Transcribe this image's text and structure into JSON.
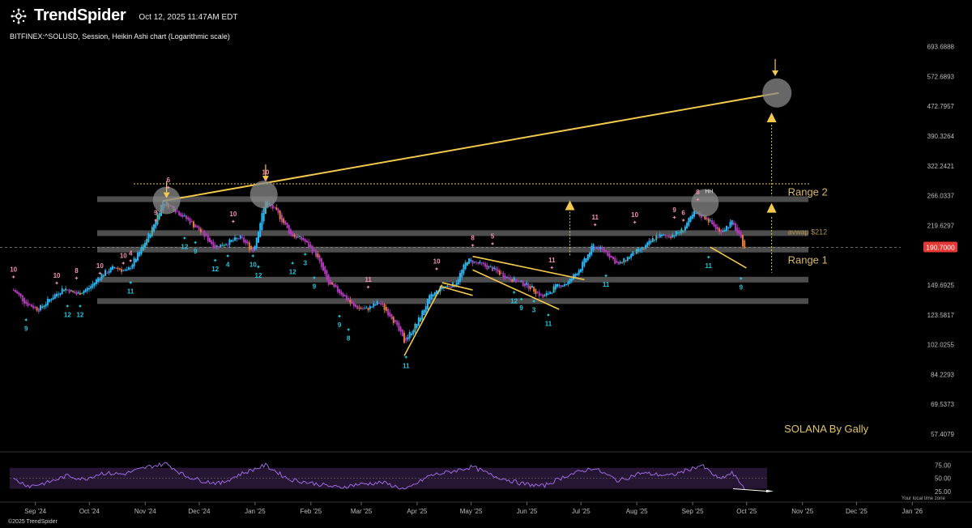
{
  "header": {
    "brand": "TrendSpider",
    "datetime": "Oct 12, 2025 11:47AM EDT",
    "symbol_line": "BITFINEX:^SOLUSD, Session, Heikin Ashi chart (Logarithmic scale)"
  },
  "footer": {
    "copyright": "©2025 TrendSpider",
    "timezone": "Your local time zone"
  },
  "colors": {
    "background": "#000000",
    "trendline": "#f2c94c",
    "zone": "#5a5a5a",
    "bull_candle": "#29b6f6",
    "bear_candle": "#b03ab8",
    "seq_top": "#f48fb1",
    "seq_bottom": "#26c6da",
    "rsi": "#9c6ade",
    "price_tag": "#e53935"
  },
  "chart_data": [
    {
      "type": "candlestick",
      "scale": "log",
      "ylim": [
        52,
        760
      ],
      "y_ticks": [
        "693.6888",
        "572.6893",
        "472.7957",
        "390.3264",
        "322.2421",
        "266.0337",
        "219.6297",
        "190.7000",
        "149.6925",
        "123.5817",
        "102.0255",
        "84.2293",
        "69.5373",
        "57.4079"
      ],
      "x_ticks": [
        "Sep '24",
        "Oct '24",
        "Nov '24",
        "Dec '24",
        "Jan '25",
        "Feb '25",
        "Mar '25",
        "Apr '25",
        "May '25",
        "Jun '25",
        "Jul '25",
        "Aug '25",
        "Sep '25",
        "Oct '25",
        "Nov '25",
        "Dec '25",
        "Jan '26"
      ],
      "last_price": "190.7000",
      "price_path": [
        [
          "2024-09-01",
          145
        ],
        [
          "2024-09-08",
          133
        ],
        [
          "2024-09-15",
          128
        ],
        [
          "2024-09-22",
          138
        ],
        [
          "2024-09-29",
          147
        ],
        [
          "2024-10-06",
          141
        ],
        [
          "2024-10-13",
          147
        ],
        [
          "2024-10-20",
          160
        ],
        [
          "2024-10-27",
          168
        ],
        [
          "2024-11-03",
          163
        ],
        [
          "2024-11-10",
          185
        ],
        [
          "2024-11-17",
          215
        ],
        [
          "2024-11-23",
          257
        ],
        [
          "2024-12-01",
          240
        ],
        [
          "2024-12-08",
          225
        ],
        [
          "2024-12-15",
          208
        ],
        [
          "2024-12-22",
          191
        ],
        [
          "2024-12-29",
          197
        ],
        [
          "2025-01-05",
          203
        ],
        [
          "2025-01-12",
          186
        ],
        [
          "2025-01-19",
          258
        ],
        [
          "2025-01-26",
          236
        ],
        [
          "2025-02-02",
          207
        ],
        [
          "2025-02-09",
          200
        ],
        [
          "2025-02-16",
          182
        ],
        [
          "2025-02-23",
          150
        ],
        [
          "2025-03-02",
          142
        ],
        [
          "2025-03-09",
          130
        ],
        [
          "2025-03-16",
          128
        ],
        [
          "2025-03-23",
          134
        ],
        [
          "2025-03-30",
          122
        ],
        [
          "2025-04-06",
          104
        ],
        [
          "2025-04-13",
          117
        ],
        [
          "2025-04-20",
          138
        ],
        [
          "2025-04-27",
          148
        ],
        [
          "2025-05-04",
          150
        ],
        [
          "2025-05-11",
          176
        ],
        [
          "2025-05-18",
          171
        ],
        [
          "2025-05-25",
          166
        ],
        [
          "2025-06-01",
          158
        ],
        [
          "2025-06-08",
          153
        ],
        [
          "2025-06-15",
          148
        ],
        [
          "2025-06-22",
          138
        ],
        [
          "2025-06-29",
          148
        ],
        [
          "2025-07-06",
          152
        ],
        [
          "2025-07-13",
          168
        ],
        [
          "2025-07-20",
          193
        ],
        [
          "2025-07-27",
          185
        ],
        [
          "2025-08-03",
          170
        ],
        [
          "2025-08-10",
          182
        ],
        [
          "2025-08-17",
          190
        ],
        [
          "2025-08-24",
          205
        ],
        [
          "2025-08-31",
          205
        ],
        [
          "2025-09-07",
          212
        ],
        [
          "2025-09-14",
          238
        ],
        [
          "2025-09-21",
          230
        ],
        [
          "2025-09-28",
          210
        ],
        [
          "2025-10-05",
          224
        ],
        [
          "2025-10-12",
          190.7
        ]
      ],
      "zones": [
        {
          "price": 260
        },
        {
          "price": 209
        },
        {
          "price": 188
        },
        {
          "price": 155
        },
        {
          "price": 135
        }
      ],
      "dotted_level": 287,
      "trendlines": [
        {
          "from": [
            "2024-11-23",
            257
          ],
          "to": [
            "2025-10-31",
            515
          ]
        },
        {
          "from": [
            "2025-04-06",
            95
          ],
          "to": [
            "2025-04-27",
            150
          ]
        },
        {
          "from": [
            "2025-04-27",
            152
          ],
          "to": [
            "2025-05-14",
            145
          ]
        },
        {
          "from": [
            "2025-04-27",
            148
          ],
          "to": [
            "2025-05-14",
            140
          ]
        },
        {
          "from": [
            "2025-05-14",
            180
          ],
          "to": [
            "2025-07-15",
            155
          ]
        },
        {
          "from": [
            "2025-05-14",
            165
          ],
          "to": [
            "2025-07-01",
            128
          ]
        },
        {
          "from": [
            "2025-09-23",
            191
          ],
          "to": [
            "2025-10-13",
            167
          ]
        }
      ],
      "circles": [
        {
          "date": "2024-11-25",
          "price": 258
        },
        {
          "date": "2025-01-18",
          "price": 268
        },
        {
          "date": "2025-09-20",
          "price": 254
        },
        {
          "date": "2025-10-30",
          "price": 515
        }
      ],
      "arrows_down": [
        {
          "date": "2024-11-25",
          "price": 292
        },
        {
          "date": "2025-01-19",
          "price": 325
        },
        {
          "date": "2025-10-29",
          "price": 640
        }
      ],
      "arrows_up": [
        {
          "date": "2025-07-07",
          "price": 250
        },
        {
          "date": "2025-10-27",
          "price": 440
        },
        {
          "date": "2025-10-27",
          "price": 246
        }
      ],
      "top_counts": [
        {
          "date": "2024-09-01",
          "price": 163,
          "label": "10"
        },
        {
          "date": "2024-09-25",
          "price": 157,
          "label": "10"
        },
        {
          "date": "2024-10-06",
          "price": 162,
          "label": "8"
        },
        {
          "date": "2024-10-19",
          "price": 167,
          "label": "10"
        },
        {
          "date": "2024-11-01",
          "price": 178,
          "label": "10"
        },
        {
          "date": "2024-11-05",
          "price": 181,
          "label": "4"
        },
        {
          "date": "2024-11-19",
          "price": 235,
          "label": "9"
        },
        {
          "date": "2024-11-26",
          "price": 290,
          "label": "6"
        },
        {
          "date": "2025-01-01",
          "price": 233,
          "label": "10"
        },
        {
          "date": "2025-01-19",
          "price": 305,
          "label": "10"
        },
        {
          "date": "2025-03-17",
          "price": 153,
          "label": "11"
        },
        {
          "date": "2025-04-24",
          "price": 172,
          "label": "10"
        },
        {
          "date": "2025-05-14",
          "price": 200,
          "label": "8"
        },
        {
          "date": "2025-05-25",
          "price": 202,
          "label": "5"
        },
        {
          "date": "2025-06-27",
          "price": 173,
          "label": "11"
        },
        {
          "date": "2025-07-21",
          "price": 228,
          "label": "11"
        },
        {
          "date": "2025-08-12",
          "price": 232,
          "label": "10"
        },
        {
          "date": "2025-09-03",
          "price": 239,
          "label": "9"
        },
        {
          "date": "2025-09-08",
          "price": 235,
          "label": "6"
        },
        {
          "date": "2025-09-16",
          "price": 268,
          "label": "8"
        }
      ],
      "bottom_counts": [
        {
          "date": "2024-09-08",
          "price": 118,
          "label": "9"
        },
        {
          "date": "2024-10-01",
          "price": 129,
          "label": "12"
        },
        {
          "date": "2024-10-08",
          "price": 129,
          "label": "12"
        },
        {
          "date": "2024-11-05",
          "price": 150,
          "label": "11"
        },
        {
          "date": "2024-12-05",
          "price": 200,
          "label": "12"
        },
        {
          "date": "2024-12-11",
          "price": 194,
          "label": "9"
        },
        {
          "date": "2024-12-22",
          "price": 173,
          "label": "12"
        },
        {
          "date": "2024-12-29",
          "price": 178,
          "label": "4"
        },
        {
          "date": "2025-01-12",
          "price": 178,
          "label": "10"
        },
        {
          "date": "2025-01-15",
          "price": 166,
          "label": "12"
        },
        {
          "date": "2025-02-03",
          "price": 170,
          "label": "12"
        },
        {
          "date": "2025-02-10",
          "price": 180,
          "label": "3"
        },
        {
          "date": "2025-02-15",
          "price": 155,
          "label": "9"
        },
        {
          "date": "2025-03-01",
          "price": 121,
          "label": "9"
        },
        {
          "date": "2025-03-06",
          "price": 111,
          "label": "8"
        },
        {
          "date": "2025-04-07",
          "price": 93,
          "label": "11"
        },
        {
          "date": "2025-06-06",
          "price": 141,
          "label": "12"
        },
        {
          "date": "2025-06-10",
          "price": 135,
          "label": "9"
        },
        {
          "date": "2025-06-17",
          "price": 133,
          "label": "3"
        },
        {
          "date": "2025-06-25",
          "price": 122,
          "label": "11"
        },
        {
          "date": "2025-07-27",
          "price": 157,
          "label": "11"
        },
        {
          "date": "2025-09-22",
          "price": 177,
          "label": "11"
        },
        {
          "date": "2025-10-10",
          "price": 154,
          "label": "9"
        }
      ],
      "annotations": [
        {
          "text": "Range 2",
          "date": "2025-11-05",
          "price": 266
        },
        {
          "text": "Range 1",
          "date": "2025-11-05",
          "price": 172
        },
        {
          "text": "avwap $212",
          "date": "2025-11-05",
          "price": 207
        },
        {
          "text": "SOLANA By Gally",
          "date": "2025-11-03",
          "price": 58
        },
        {
          "text": "HH",
          "date": "2025-09-20",
          "price": 270
        }
      ]
    },
    {
      "type": "line",
      "name": "RSI",
      "ylim": [
        20,
        85
      ],
      "y_ticks": [
        "75.00",
        "50.00",
        "25.00"
      ],
      "bands": [
        70,
        30
      ],
      "midline": 50,
      "values": [
        [
          "2024-09-01",
          48
        ],
        [
          "2024-09-10",
          35
        ],
        [
          "2024-09-20",
          42
        ],
        [
          "2024-10-01",
          55
        ],
        [
          "2024-10-10",
          48
        ],
        [
          "2024-10-20",
          60
        ],
        [
          "2024-11-01",
          58
        ],
        [
          "2024-11-15",
          72
        ],
        [
          "2024-11-25",
          78
        ],
        [
          "2024-12-05",
          55
        ],
        [
          "2024-12-15",
          45
        ],
        [
          "2024-12-25",
          40
        ],
        [
          "2025-01-05",
          58
        ],
        [
          "2025-01-19",
          75
        ],
        [
          "2025-02-01",
          48
        ],
        [
          "2025-02-15",
          40
        ],
        [
          "2025-03-01",
          32
        ],
        [
          "2025-03-10",
          38
        ],
        [
          "2025-03-25",
          42
        ],
        [
          "2025-04-07",
          28
        ],
        [
          "2025-04-20",
          55
        ],
        [
          "2025-05-01",
          62
        ],
        [
          "2025-05-14",
          72
        ],
        [
          "2025-05-25",
          55
        ],
        [
          "2025-06-10",
          40
        ],
        [
          "2025-06-22",
          35
        ],
        [
          "2025-07-05",
          55
        ],
        [
          "2025-07-20",
          70
        ],
        [
          "2025-08-03",
          45
        ],
        [
          "2025-08-15",
          60
        ],
        [
          "2025-09-01",
          55
        ],
        [
          "2025-09-18",
          75
        ],
        [
          "2025-09-28",
          48
        ],
        [
          "2025-10-05",
          60
        ],
        [
          "2025-10-12",
          32
        ]
      ]
    }
  ]
}
